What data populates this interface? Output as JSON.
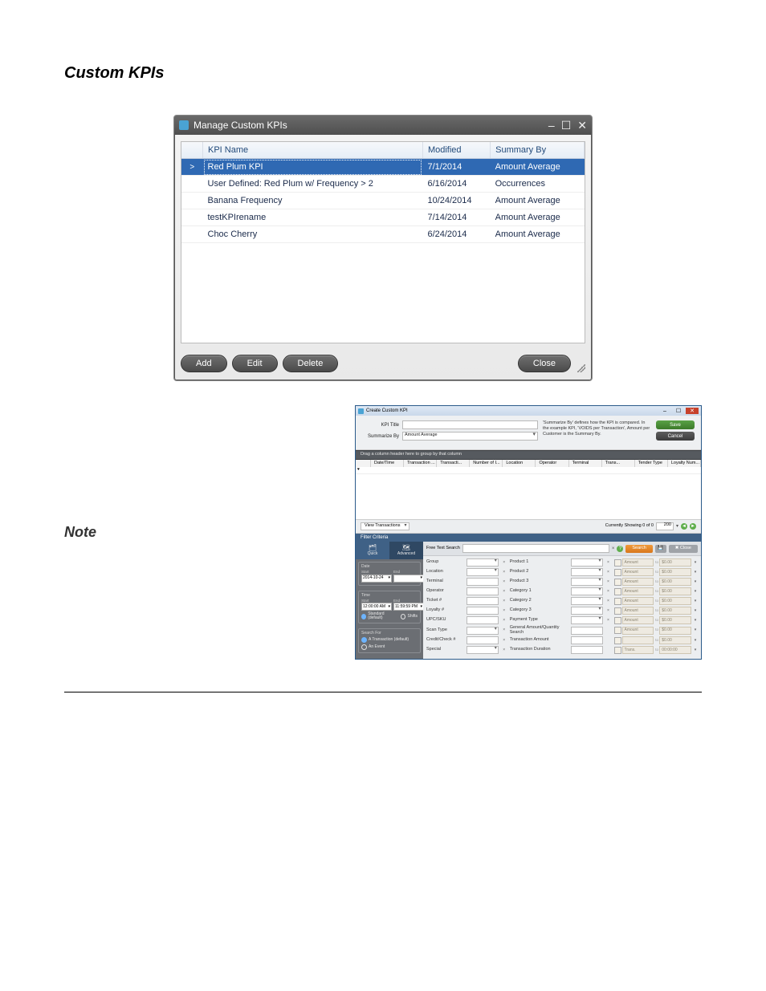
{
  "heading": "Custom KPIs",
  "note_label": "Note",
  "shot1": {
    "title": "Manage Custom KPIs",
    "window_controls": {
      "minimize": "‒",
      "maximize": "☐",
      "close": "✕"
    },
    "columns": [
      "",
      "KPI Name",
      "Modified",
      "Summary By"
    ],
    "rows": [
      {
        "caret": ">",
        "name": "Red Plum KPI",
        "modified": "7/1/2014",
        "summary": "Amount Average",
        "selected": true
      },
      {
        "caret": "",
        "name": "User Defined: Red Plum w/ Frequency > 2",
        "modified": "6/16/2014",
        "summary": "Occurrences",
        "selected": false
      },
      {
        "caret": "",
        "name": "Banana Frequency",
        "modified": "10/24/2014",
        "summary": "Amount Average",
        "selected": false
      },
      {
        "caret": "",
        "name": "testKPIrename",
        "modified": "7/14/2014",
        "summary": "Amount Average",
        "selected": false
      },
      {
        "caret": "",
        "name": "Choc Cherry",
        "modified": "6/24/2014",
        "summary": "Amount Average",
        "selected": false
      }
    ],
    "buttons": {
      "add": "Add",
      "edit": "Edit",
      "delete": "Delete",
      "close": "Close"
    }
  },
  "shot2": {
    "title": "Create Custom KPI",
    "window_controls": {
      "minimize": "‒",
      "maximize": "☐",
      "close": "✕"
    },
    "labels": {
      "kpi_title": "KPI Title",
      "summarize_by": "Summarize By"
    },
    "values": {
      "kpi_title": "",
      "summarize_by": "Amount Average"
    },
    "help_text": "'Summarize By' defines how the KPI is compared. In the example KPI, 'VOIDS per Transaction', Amount per Customer is the Summary By.",
    "buttons": {
      "save": "Save",
      "cancel": "Cancel"
    },
    "group_hint": "Drag a column header here to group by that column",
    "grid_columns": [
      "",
      "Date/Time",
      "Transaction ...",
      "Transacti...",
      "Number of I...",
      "Location",
      "Operator",
      "Terminal",
      "Trans...",
      "Tender Type",
      "Loyalty Num..."
    ],
    "filter_row_marker": "♥",
    "view_dropdown": "View Transactions",
    "currently_showing": "Currently Showing 0 of 0",
    "page_box": "200",
    "filter_header": "Filter Criteria",
    "side": {
      "tab_quick": "Quick",
      "tab_advanced": "Advanced",
      "group_date": "Date",
      "label_start": "Start",
      "label_end": "End",
      "date_start": "2014-10-24",
      "date_end": "",
      "group_time": "Time",
      "time_start": "12:00:00 AM",
      "time_end": "11:59:59 PM",
      "radio_standard": "Standard (default)",
      "radio_shifts": "Shifts",
      "group_search": "Search For",
      "radio_tx": "A Transaction (default)",
      "radio_event": "An Event"
    },
    "searchbar": {
      "label": "Free Text Search",
      "clear": "×",
      "helpq": "?",
      "search": "Search",
      "save": "💾",
      "close": "✖ Close"
    },
    "criteria": [
      {
        "l1": "Group",
        "l2": "Product 1",
        "amt": "Amount",
        "to": "$0.00",
        "dd1": true,
        "x1": true,
        "dd2": true,
        "x2": true
      },
      {
        "l1": "Location",
        "l2": "Product 2",
        "amt": "Amount",
        "to": "$0.00",
        "dd1": true,
        "x1": true,
        "dd2": true,
        "x2": true
      },
      {
        "l1": "Terminal",
        "l2": "Product 3",
        "amt": "Amount",
        "to": "$0.00",
        "dd1": false,
        "x1": true,
        "dd2": true,
        "x2": true
      },
      {
        "l1": "Operator",
        "l2": "Category 1",
        "amt": "Amount",
        "to": "$0.00",
        "dd1": false,
        "x1": true,
        "dd2": true,
        "x2": true
      },
      {
        "l1": "Ticket #",
        "l2": "Category 2",
        "amt": "Amount",
        "to": "$0.00",
        "dd1": false,
        "x1": true,
        "dd2": true,
        "x2": true
      },
      {
        "l1": "Loyalty #",
        "l2": "Category 3",
        "amt": "Amount",
        "to": "$0.00",
        "dd1": false,
        "x1": true,
        "dd2": true,
        "x2": true
      },
      {
        "l1": "UPC/SKU",
        "l2": "Payment Type",
        "amt": "Amount",
        "to": "$0.00",
        "dd1": false,
        "x1": true,
        "dd2": true,
        "x2": true
      },
      {
        "l1": "Scan Type",
        "l2": "General Amount/Quantity Search",
        "amt": "Amount",
        "to": "$0.00",
        "dd1": true,
        "x1": true,
        "dd2": false,
        "x2": false
      },
      {
        "l1": "Credit/Check #",
        "l2": "Transaction Amount",
        "amt": "",
        "to": "$0.00",
        "dd1": false,
        "x1": true,
        "dd2": false,
        "x2": false
      },
      {
        "l1": "Special",
        "l2": "Transaction Duration",
        "amt": "Trans.",
        "to": "00:00:00",
        "dd1": true,
        "x1": true,
        "dd2": false,
        "x2": false
      }
    ]
  }
}
